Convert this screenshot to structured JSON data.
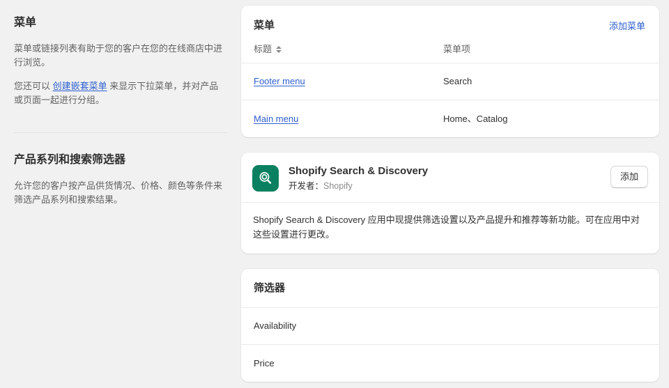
{
  "sidebar": {
    "sections": [
      {
        "title": "菜单",
        "paragraph1": "菜单或链接列表有助于您的客户在您的在线商店中进行浏览。",
        "paragraph2_before": "您还可以 ",
        "paragraph2_link": "创建嵌套菜单",
        "paragraph2_after": " 来显示下拉菜单，并对产品或页面一起进行分组。"
      },
      {
        "title": "产品系列和搜索筛选器",
        "paragraph1": "允许您的客户按产品供货情况、价格、颜色等条件来筛选产品系列和搜索结果。"
      }
    ]
  },
  "menus_card": {
    "title": "菜单",
    "add_link": "添加菜单",
    "columns": [
      "标题",
      "菜单项"
    ],
    "sort_icon": "sort-arrows-icon",
    "rows": [
      {
        "title": "Footer menu",
        "items": "Search"
      },
      {
        "title": "Main menu",
        "items": "Home、Catalog"
      }
    ]
  },
  "app_card": {
    "icon": "search-magnifier-icon",
    "icon_color": "#098060",
    "name": "Shopify Search & Discovery",
    "developer_label": "开发者：",
    "developer_value": "Shopify",
    "add_button": "添加",
    "description": "Shopify Search & Discovery 应用中现提供筛选设置以及产品提升和推荐等新功能。可在应用中对这些设置进行更改。"
  },
  "filters_card": {
    "title": "筛选器",
    "rows": [
      "Availability",
      "Price"
    ]
  },
  "colors": {
    "link": "#2c5ecf",
    "page_bg": "#f1f1f1",
    "card_bg": "#ffffff",
    "text": "#303030",
    "subdued_text": "#616161",
    "border": "#ebebeb"
  }
}
